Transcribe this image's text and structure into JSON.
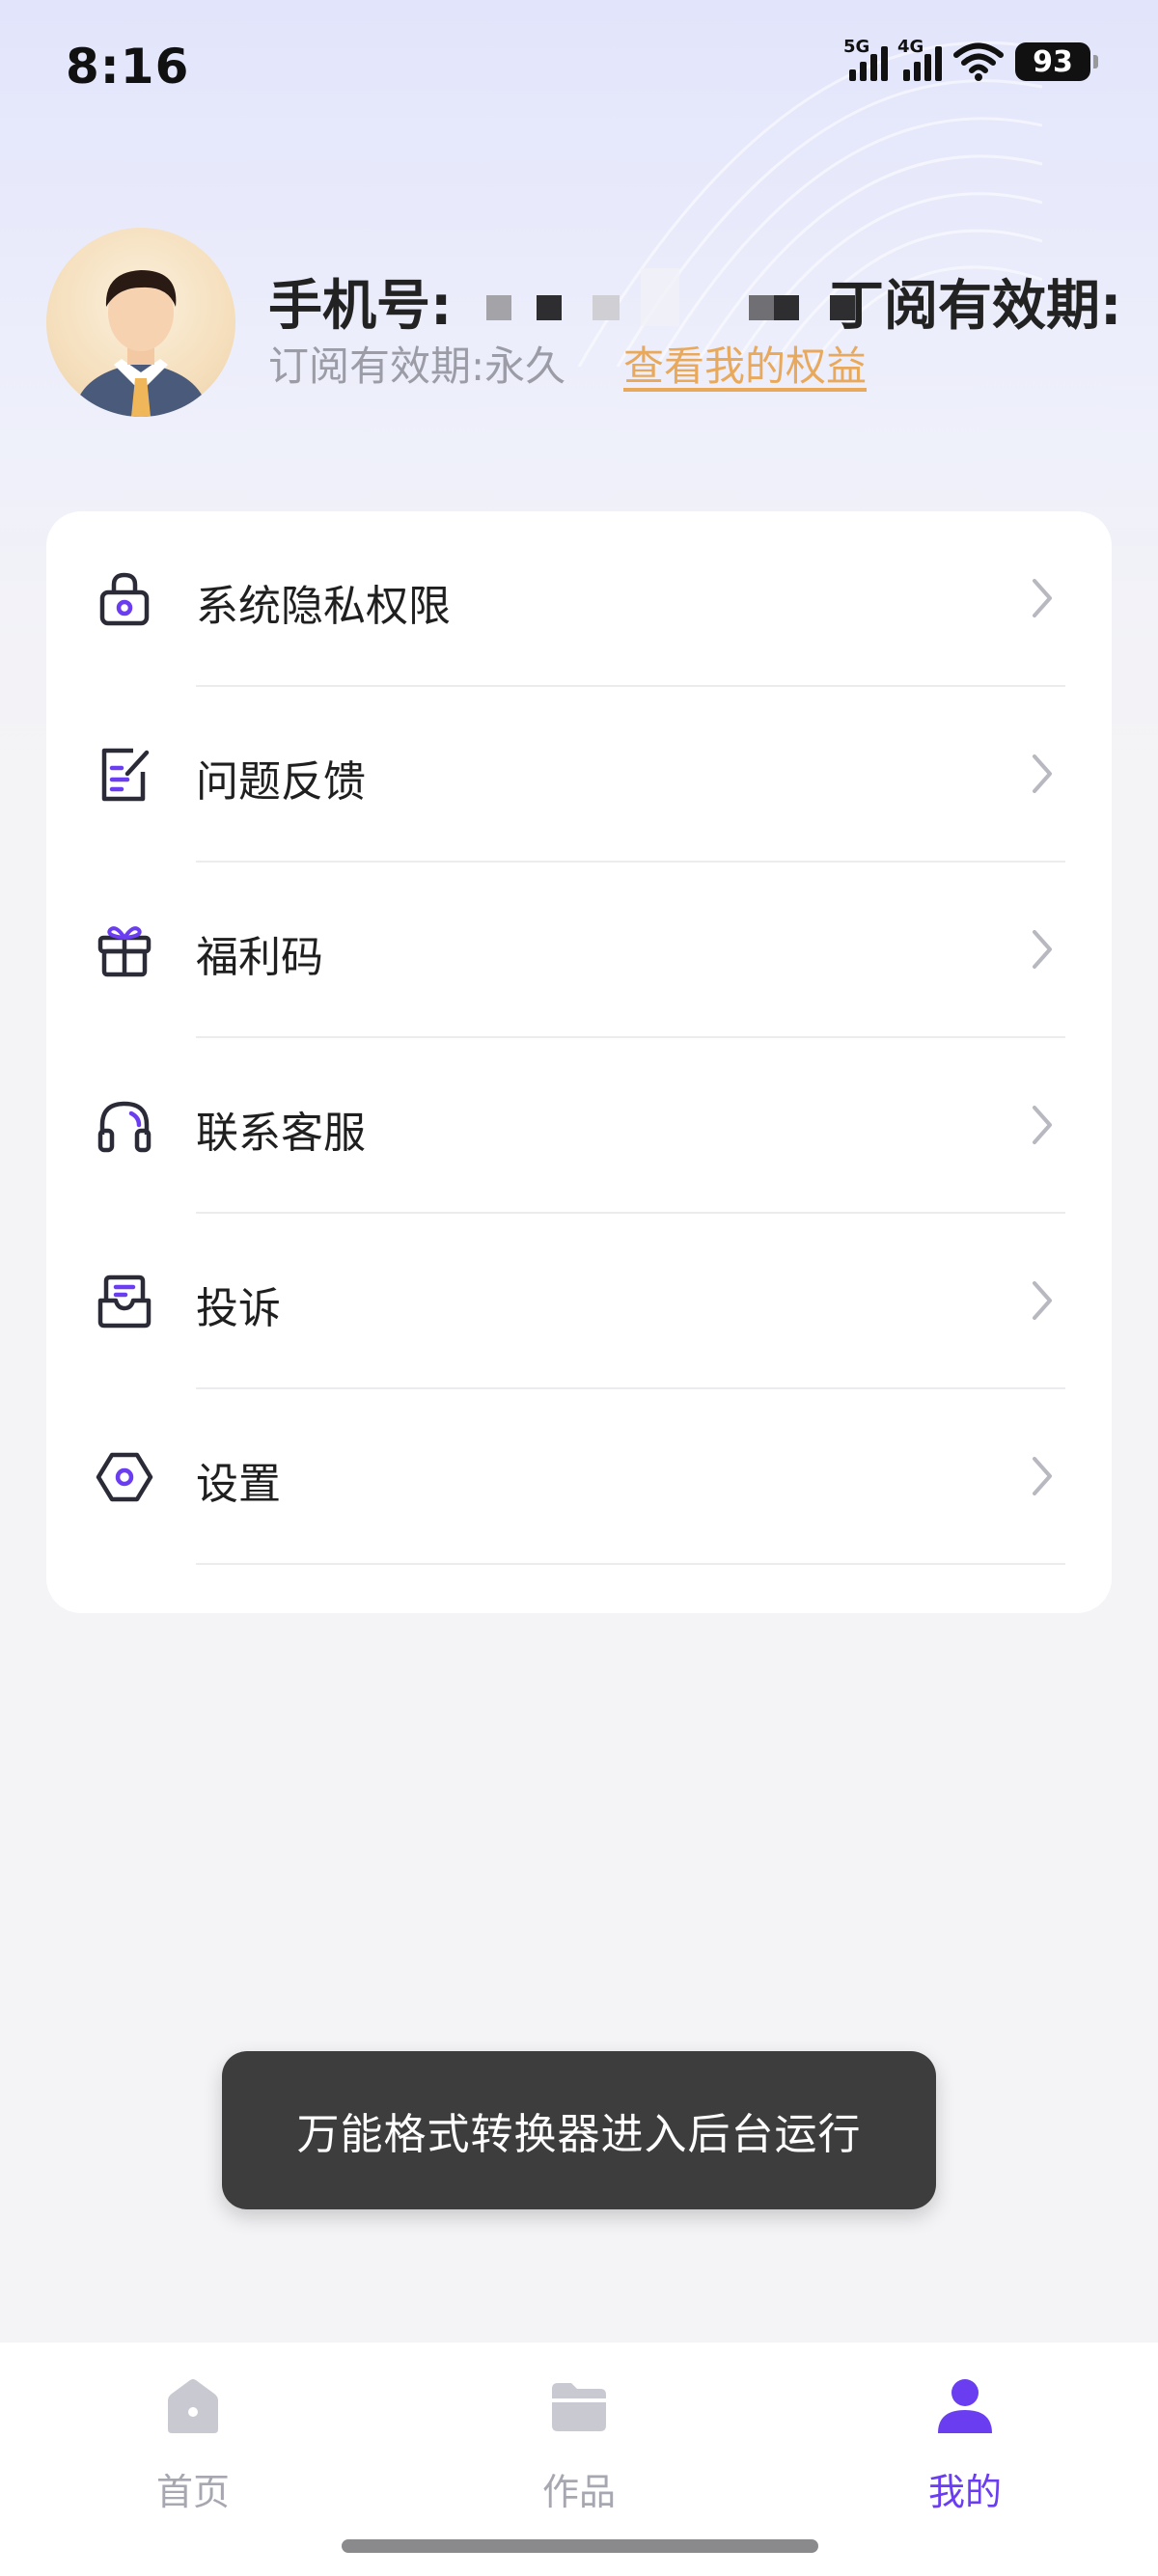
{
  "status_bar": {
    "time": "8:16",
    "network_1": "5G",
    "network_2": "4G",
    "battery": "93",
    "icons": [
      "cellular-signal-icon",
      "cellular-signal-icon",
      "wifi-icon",
      "battery-icon"
    ]
  },
  "profile": {
    "phone_label": "手机号:",
    "overflow_label": "丁阅有效期:",
    "subscription_text": "订阅有效期:永久",
    "rights_link": "查看我的权益"
  },
  "menu": {
    "items": [
      {
        "label": "系统隐私权限",
        "icon": "lock-icon"
      },
      {
        "label": "问题反馈",
        "icon": "feedback-edit-icon"
      },
      {
        "label": "福利码",
        "icon": "gift-icon"
      },
      {
        "label": "联系客服",
        "icon": "headphones-icon"
      },
      {
        "label": "投诉",
        "icon": "complaint-mailbox-icon"
      },
      {
        "label": "设置",
        "icon": "settings-hexagon-icon"
      }
    ]
  },
  "toast": {
    "text": "万能格式转换器进入后台运行"
  },
  "tab_bar": {
    "tabs": [
      {
        "label": "首页",
        "icon": "home-icon",
        "active": false
      },
      {
        "label": "作品",
        "icon": "folder-icon",
        "active": false
      },
      {
        "label": "我的",
        "icon": "user-icon",
        "active": true
      }
    ]
  },
  "colors": {
    "accent": "#6a3df0",
    "link": "#e9a95c",
    "toast_bg": "#3d3d3d"
  }
}
